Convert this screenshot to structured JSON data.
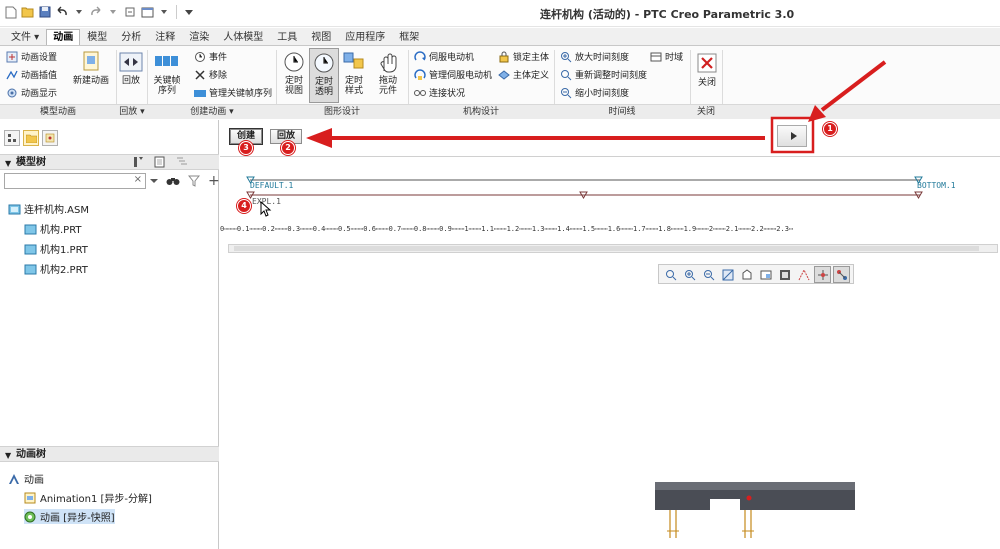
{
  "window": {
    "title": "连杆机构 (活动的) - PTC Creo Parametric 3.0"
  },
  "tabs": [
    {
      "label": "文件 ▾"
    },
    {
      "label": "动画"
    },
    {
      "label": "模型"
    },
    {
      "label": "分析"
    },
    {
      "label": "注释"
    },
    {
      "label": "渲染"
    },
    {
      "label": "人体模型"
    },
    {
      "label": "工具"
    },
    {
      "label": "视图"
    },
    {
      "label": "应用程序"
    },
    {
      "label": "框架"
    }
  ],
  "ribbon": {
    "groups": {
      "model_anim": "模型动画",
      "playback": "回放 ▾",
      "create_anim": "创建动画 ▾",
      "graphic_design": "图形设计",
      "mech_design": "机构设计",
      "timeline": "时间线",
      "close": "关闭"
    },
    "buttons": {
      "anim_settings": "动画设置",
      "anim_interp": "动画插值",
      "anim_display": "动画显示",
      "new_anim": "新建动画",
      "playback": "回放",
      "keyframe_seq_1": "关键帧",
      "keyframe_seq_2": "序列",
      "event": "事件",
      "remove": "移除",
      "manage_keyframe": "管理关键帧序列",
      "custom_view_1": "定时",
      "custom_view_2": "视图",
      "custom_trans_1": "定时",
      "custom_trans_2": "透明",
      "custom_style_1": "定时",
      "custom_style_2": "样式",
      "drag_1": "拖动",
      "drag_2": "元件",
      "servo_motor": "伺服电动机",
      "manage_servo": "管理伺服电动机",
      "connection_status": "连接状况",
      "lock_body": "锁定主体",
      "body_def": "主体定义",
      "zoom_in_time": "放大时间刻度",
      "readjust_time": "重新调整时间刻度",
      "zoom_out_time": "缩小时间刻度",
      "time_domain": "时域",
      "close": "关闭"
    }
  },
  "panel": {
    "create": "创建",
    "playback": "回放"
  },
  "model_tree": {
    "title": "模型树",
    "items": [
      {
        "label": "连杆机构.ASM"
      },
      {
        "label": "机构.PRT"
      },
      {
        "label": "机构1.PRT"
      },
      {
        "label": "机构2.PRT"
      }
    ]
  },
  "anim_tree": {
    "title": "动画树",
    "items": [
      {
        "label": "动画"
      },
      {
        "label": "Animation1 [异步-分解]"
      },
      {
        "label": "动画 [异步-快照]"
      }
    ]
  },
  "timeline": {
    "start_label": "DEFAULT.1",
    "end_label": "BOTTOM.1",
    "row2_label": "EXPL.1",
    "ruler": "0⋯⋯⋯0.1⋯⋯⋯0.2⋯⋯⋯0.3⋯⋯⋯0.4⋯⋯⋯0.5⋯⋯⋯0.6⋯⋯⋯0.7⋯⋯⋯0.8⋯⋯⋯0.9⋯⋯⋯1⋯⋯⋯1.1⋯⋯⋯1.2⋯⋯⋯1.3⋯⋯⋯1.4⋯⋯⋯1.5⋯⋯⋯1.6⋯⋯⋯1.7⋯⋯⋯1.8⋯⋯⋯1.9⋯⋯⋯2⋯⋯⋯2.1⋯⋯⋯2.2⋯⋯⋯2.3⋯"
  },
  "badges": {
    "b1": "1",
    "b2": "2",
    "b3": "3",
    "b4": "4"
  },
  "colors": {
    "annotation_red": "#d81e1e",
    "timeline_label": "#227a9a"
  }
}
